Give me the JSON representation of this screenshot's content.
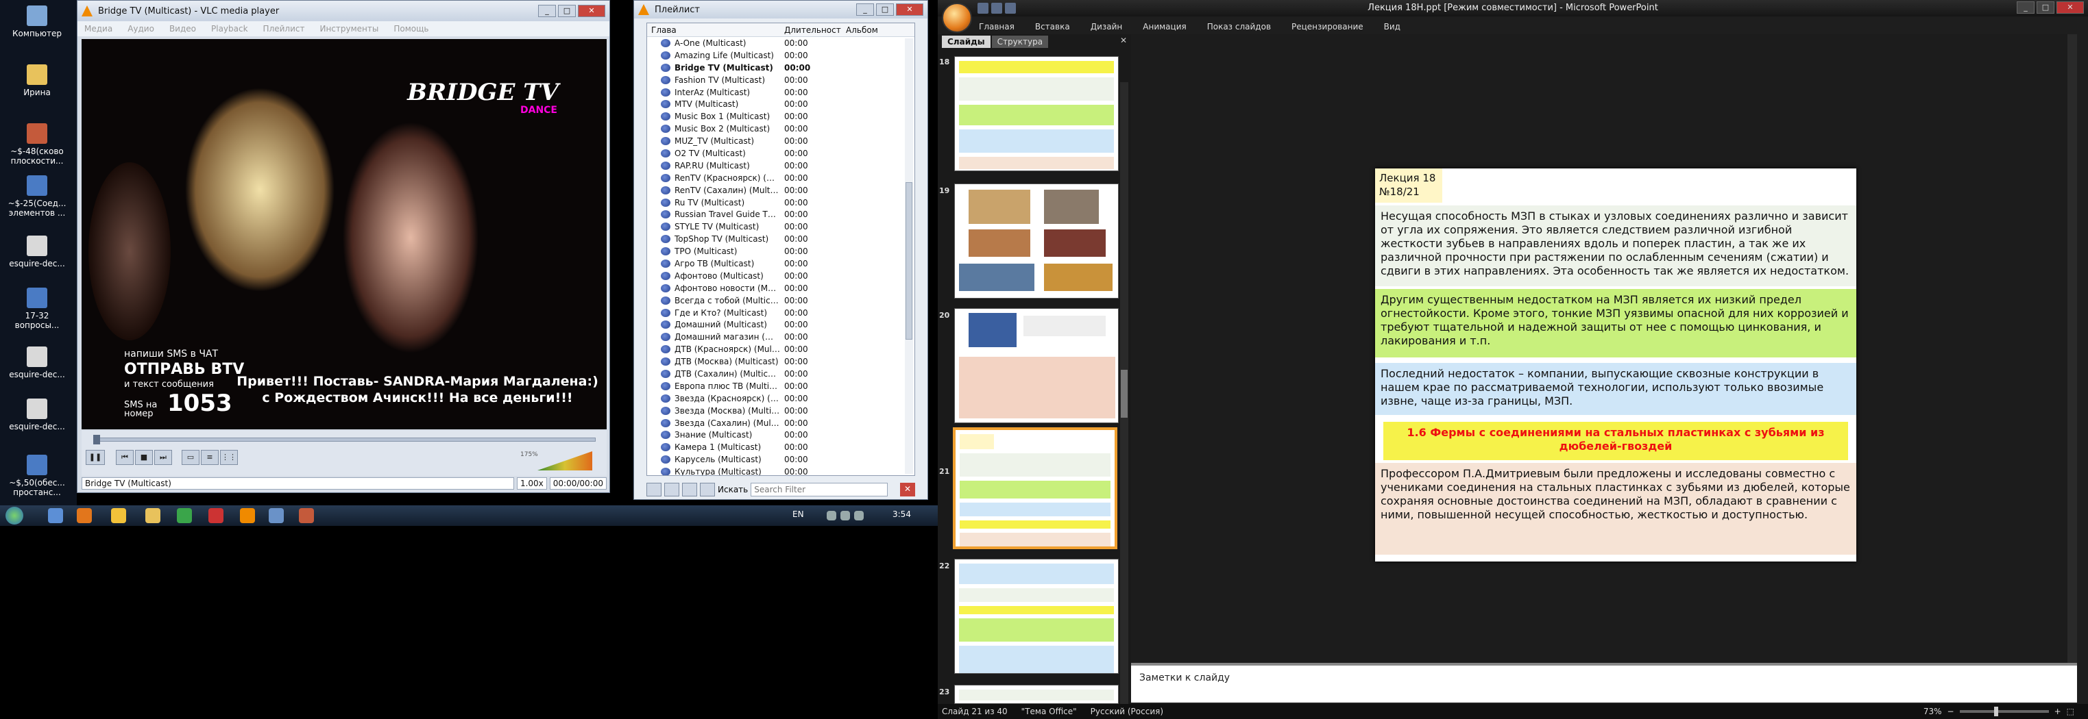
{
  "desktop": {
    "icons": [
      {
        "label": "Компьютер"
      },
      {
        "label": "Ирина"
      },
      {
        "label": "~$-48(сково плоскости..."
      },
      {
        "label": "~$-25(Соед... элементов ..."
      },
      {
        "label": "esquire-dec..."
      },
      {
        "label": "17-32 вопросы..."
      },
      {
        "label": "esquire-dec..."
      },
      {
        "label": "esquire-dec..."
      },
      {
        "label": "~$,50(обес... простанс..."
      }
    ]
  },
  "vlc": {
    "title": "Bridge TV (Multicast) - VLC media player",
    "menu": [
      "Медиа",
      "Аудио",
      "Видео",
      "Playback",
      "Плейлист",
      "Инструменты",
      "Помощь"
    ],
    "video": {
      "logo": "BRIDGE TV",
      "logo_sub": "DANCE",
      "sms_line1": "напиши SMS в ЧАТ",
      "sms_line2": "ОТПРАВЬ BTV",
      "sms_line3": "и текст сообщения",
      "sms_line4": "SMS на номер",
      "sms_number": "1053",
      "ticker": "Привет!!! Поставь- SANDRA-Мария Магдалена:) с Рождеством Ачинск!!! На все деньги!!!"
    },
    "volume_percent": "175%",
    "volume_level": 1.75,
    "status_track": "Bridge TV (Multicast)",
    "speed": "1.00x",
    "time": "00:00/00:00"
  },
  "playlist": {
    "title": "Плейлист",
    "columns": [
      "Глава",
      "Длительност",
      "Альбом"
    ],
    "items": [
      {
        "name": "A-One (Multicast)",
        "dur": "00:00",
        "bold": false
      },
      {
        "name": "Amazing Life (Multicast)",
        "dur": "00:00",
        "bold": false
      },
      {
        "name": "Bridge TV (Multicast)",
        "dur": "00:00",
        "bold": true
      },
      {
        "name": "Fashion TV (Multicast)",
        "dur": "00:00",
        "bold": false
      },
      {
        "name": "InterAz (Multicast)",
        "dur": "00:00",
        "bold": false
      },
      {
        "name": "MTV (Multicast)",
        "dur": "00:00",
        "bold": false
      },
      {
        "name": "Music Box 1 (Multicast)",
        "dur": "00:00",
        "bold": false
      },
      {
        "name": "Music Box 2 (Multicast)",
        "dur": "00:00",
        "bold": false
      },
      {
        "name": "MUZ_TV (Multicast)",
        "dur": "00:00",
        "bold": false
      },
      {
        "name": "O2 TV (Multicast)",
        "dur": "00:00",
        "bold": false
      },
      {
        "name": "RAP.RU (Multicast)",
        "dur": "00:00",
        "bold": false
      },
      {
        "name": "RenTV (Красноярск) (Mul...",
        "dur": "00:00",
        "bold": false
      },
      {
        "name": "RenTV (Сахалин) (Multicast)",
        "dur": "00:00",
        "bold": false
      },
      {
        "name": "Ru TV (Multicast)",
        "dur": "00:00",
        "bold": false
      },
      {
        "name": "Russian Travel Guide TV (...",
        "dur": "00:00",
        "bold": false
      },
      {
        "name": "STYLE TV (Multicast)",
        "dur": "00:00",
        "bold": false
      },
      {
        "name": "TopShop TV (Multicast)",
        "dur": "00:00",
        "bold": false
      },
      {
        "name": "TPO (Multicast)",
        "dur": "00:00",
        "bold": false
      },
      {
        "name": "Агро ТВ (Multicast)",
        "dur": "00:00",
        "bold": false
      },
      {
        "name": "Афонтово (Multicast)",
        "dur": "00:00",
        "bold": false
      },
      {
        "name": "Афонтово новости (Multi...",
        "dur": "00:00",
        "bold": false
      },
      {
        "name": "Всегда с тобой (Multicast)",
        "dur": "00:00",
        "bold": false
      },
      {
        "name": "Где и Кто? (Multicast)",
        "dur": "00:00",
        "bold": false
      },
      {
        "name": "Домашний (Multicast)",
        "dur": "00:00",
        "bold": false
      },
      {
        "name": "Домашний магазин (Mul...",
        "dur": "00:00",
        "bold": false
      },
      {
        "name": "ДТВ (Красноярск) (Multic...",
        "dur": "00:00",
        "bold": false
      },
      {
        "name": "ДТВ (Москва) (Multicast)",
        "dur": "00:00",
        "bold": false
      },
      {
        "name": "ДТВ (Сахалин) (Multicast)",
        "dur": "00:00",
        "bold": false
      },
      {
        "name": "Европа плюс ТВ (Multicast)",
        "dur": "00:00",
        "bold": false
      },
      {
        "name": "Звезда (Красноярск) (Mul...",
        "dur": "00:00",
        "bold": false
      },
      {
        "name": "Звезда (Москва) (Multicast)",
        "dur": "00:00",
        "bold": false
      },
      {
        "name": "Звезда (Сахалин) (Multic...",
        "dur": "00:00",
        "bold": false
      },
      {
        "name": "Знание (Multicast)",
        "dur": "00:00",
        "bold": false
      },
      {
        "name": "Камера 1 (Multicast)",
        "dur": "00:00",
        "bold": false
      },
      {
        "name": "Карусель (Multicast)",
        "dur": "00:00",
        "bold": false
      },
      {
        "name": "Культура (Multicast)",
        "dur": "00:00",
        "bold": false
      }
    ],
    "search_label": "Искать",
    "search_placeholder": "Search Filter"
  },
  "taskbar": {
    "lang": "EN",
    "clock": "3:54"
  },
  "ppt": {
    "title": "Лекция 18Н.ppt [Режим совместимости] - Microsoft PowerPoint",
    "ribbon_tabs": [
      "Главная",
      "Вставка",
      "Дизайн",
      "Анимация",
      "Показ слайдов",
      "Рецензирование",
      "Вид"
    ],
    "pane_tabs": [
      "Слайды",
      "Структура"
    ],
    "thumb_numbers": [
      "18",
      "19",
      "20",
      "21",
      "22",
      "23"
    ],
    "slide": {
      "header_line1": "Лекция 18",
      "header_line2": "№18/21",
      "p1": "Несущая способность МЗП в стыках и узловых соединениях различно и зависит от угла  их сопряжения. Это является следствием различной изгибной жесткости зубьев в направлениях вдоль и поперек пластин, а так же их различной прочности при растяжении по ослабленным сечениям (сжатии) и сдвиги в этих направлениях. Эта особенность так же является их недостатком.",
      "p2": "Другим существенным недостатком на МЗП является их низкий предел огнестойкости. Кроме этого, тонкие МЗП уязвимы опасной для них коррозией и требуют тщательной и надежной защиты от нее с помощью цинкования, и лакирования и т.п.",
      "p3": "Последний недостаток – компании, выпускающие сквозные конструкции  в нашем крае по рассматриваемой технологии, используют только ввозимые извне, чаще из-за границы, МЗП.",
      "heading": "1.6 Фермы с соединениями на стальных пластинках с зубьями из дюбелей-гвоздей",
      "p4": "Профессором П.А.Дмитриевым были предложены и исследованы совместно с учениками соединения на стальных пластинках с зубьями из дюбелей, которые сохраняя основные достоинства соединений на МЗП, обладают в сравнении с ними, повышенной несущей способностью, жесткостью и доступностью."
    },
    "notes_placeholder": "Заметки к слайду",
    "status": {
      "slide": "Слайд 21 из 40",
      "theme": "\"Тема Office\"",
      "lang": "Русский (Россия)",
      "zoom": "73%"
    },
    "colors": {
      "green": "#c8f07c",
      "blue": "#cfe6f8",
      "yellow": "#f6f24a",
      "peach": "#f6e3d5",
      "red": "#e11111"
    }
  }
}
